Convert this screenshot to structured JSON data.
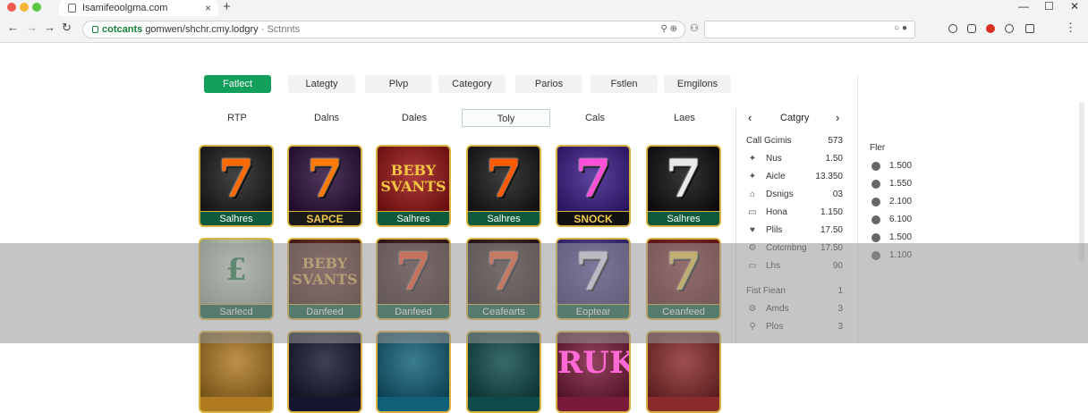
{
  "browser": {
    "tab_title": "Isamifeoolgma.com",
    "tab_close": "×",
    "new_tab": "+",
    "back": "←",
    "forward": "→",
    "forward2": "→",
    "reload": "↻",
    "address": {
      "secure_label": "cotcants",
      "url": "gomwen/shchr.cmy.lodgry",
      "crumb": "· Sctnnts",
      "icons": "⚲ ⊕"
    },
    "window_controls": {
      "minimize": "—",
      "maximize": "☐",
      "close": "✕"
    }
  },
  "filters": [
    {
      "label": "Fatlect",
      "active": true
    },
    {
      "label": "Lategty",
      "active": false
    },
    {
      "label": "Plvp",
      "active": false
    },
    {
      "label": "Category",
      "active": false
    },
    {
      "label": "Parios",
      "active": false
    },
    {
      "label": "Fstlen",
      "active": false
    },
    {
      "label": "Emgilons",
      "active": false
    }
  ],
  "subtabs": [
    {
      "label": "RTP",
      "active": false
    },
    {
      "label": "Dalns",
      "active": false
    },
    {
      "label": "Dales",
      "active": false
    },
    {
      "label": "Toly",
      "active": true
    },
    {
      "label": "Cals",
      "active": false
    },
    {
      "label": "Laes",
      "active": false
    }
  ],
  "games": [
    {
      "label": "Salhres",
      "art": "seven",
      "bg": "#1a1a1a",
      "seven_color": "#ff6a00",
      "banner": "green"
    },
    {
      "label": "SAPCE",
      "art": "seven",
      "bg": "#2a0c3a",
      "seven_color": "#ff7a00",
      "banner": "gold"
    },
    {
      "label": "Salhres",
      "art": "text",
      "text": "BEBY SVANTS",
      "bg": "#9a1010",
      "text_color": "#f4c542",
      "banner": "green"
    },
    {
      "label": "Salhres",
      "art": "seven",
      "bg": "#141414",
      "seven_color": "#ff5a00",
      "banner": "green"
    },
    {
      "label": "SNOCK",
      "art": "seven",
      "bg": "#3a1a8a",
      "seven_color": "#ff4fd8",
      "banner": "black"
    },
    {
      "label": "Salhres",
      "art": "seven",
      "bg": "#0a0a0a",
      "seven_color": "#e9e9e9",
      "banner": "green"
    },
    {
      "label": "Sarlecd",
      "art": "text",
      "text": "£",
      "bg": "#cfe0c8",
      "text_color": "#1f7a4a",
      "banner": "green"
    },
    {
      "label": "Danfeed",
      "art": "text",
      "text": "BEBY SVANTS",
      "bg": "#5a1a10",
      "text_color": "#d9a84a",
      "banner": "green"
    },
    {
      "label": "Danfeed",
      "art": "seven",
      "bg": "#3a1010",
      "seven_color": "#ff4a1a",
      "banner": "green"
    },
    {
      "label": "Ceafearts",
      "art": "seven",
      "bg": "#2a1010",
      "seven_color": "#ff5a2a",
      "banner": "green"
    },
    {
      "label": "Eoptear",
      "art": "seven",
      "bg": "#3a2a8a",
      "seven_color": "#e8e8ff",
      "banner": "green"
    },
    {
      "label": "Ceanfeed",
      "art": "seven",
      "bg": "#7a1010",
      "seven_color": "#f2c94c",
      "banner": "green"
    },
    {
      "label": "",
      "art": "blank",
      "bg": "#b07a20",
      "banner": "none"
    },
    {
      "label": "",
      "art": "blank",
      "bg": "#151530",
      "banner": "none"
    },
    {
      "label": "",
      "art": "blank",
      "bg": "#10607a",
      "banner": "none"
    },
    {
      "label": "",
      "art": "blank",
      "bg": "#0e4a4a",
      "banner": "none"
    },
    {
      "label": "",
      "art": "text",
      "text": "RUK",
      "bg": "#7a1a3a",
      "text_color": "#ff6ad5",
      "banner": "none"
    },
    {
      "label": "",
      "art": "blank",
      "bg": "#8a2a2a",
      "banner": "none"
    }
  ],
  "sidepanel": {
    "header": {
      "title": "Catgry",
      "prev": "‹",
      "next": "›"
    },
    "rows": [
      {
        "icon": "",
        "label": "Call Gcimis",
        "value": "573",
        "is_head": true
      },
      {
        "icon": "✦",
        "label": "Nus",
        "value": "1.50"
      },
      {
        "icon": "✦",
        "label": "Aicle",
        "value": "13.350"
      },
      {
        "icon": "⌂",
        "label": "Dsnigs",
        "value": "03"
      },
      {
        "icon": "▭",
        "label": "Hona",
        "value": "1.150"
      },
      {
        "icon": "♥",
        "label": "Plils",
        "value": "17.50"
      },
      {
        "icon": "⚙",
        "label": "Cotcmbng",
        "value": "17.50"
      },
      {
        "icon": "▭",
        "label": "Lhs",
        "value": "90"
      },
      {
        "icon": "",
        "label": "Fist Fiean",
        "value": "1",
        "is_head": true
      },
      {
        "icon": "⚙",
        "label": "Amds",
        "value": "3"
      },
      {
        "icon": "⚲",
        "label": "Plos",
        "value": "3"
      }
    ]
  },
  "sidepanel2": {
    "title": "Fler",
    "values": [
      "1.500",
      "1.550",
      "2.100",
      "6.100",
      "1.500",
      "1.100"
    ]
  }
}
